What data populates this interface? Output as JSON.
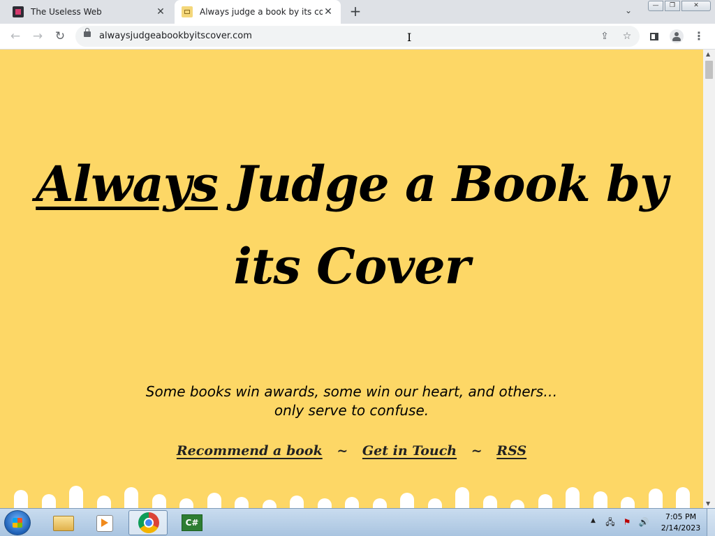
{
  "browser": {
    "tabs": [
      {
        "title": "The Useless Web",
        "favicon": "useless-web-icon",
        "active": false
      },
      {
        "title": "Always judge a book by its cover",
        "favicon": "book-icon",
        "active": true
      }
    ],
    "new_tab_label": "+",
    "tab_search_label": "⌄",
    "url": "alwaysjudgeabookbyitscover.com",
    "window_controls": {
      "minimize": "—",
      "maximize": "❐",
      "close": "✕"
    }
  },
  "page": {
    "background_color": "#fdd766",
    "headline_underlined": "Always",
    "headline_rest": " Judge a Book by its Cover",
    "tagline": "Some books win awards, some win our heart, and others… only serve to confuse.",
    "links": [
      {
        "label": "Recommend a book"
      },
      {
        "label": "Get in Touch"
      },
      {
        "label": "RSS"
      }
    ],
    "link_separator": "~"
  },
  "taskbar": {
    "apps": [
      "windows-explorer-icon",
      "media-player-icon",
      "chrome-icon",
      "csharp-icon"
    ],
    "active_app": "chrome-icon",
    "csharp_label": "C#",
    "clock": {
      "time": "7:05 PM",
      "date": "2/14/2023"
    }
  }
}
